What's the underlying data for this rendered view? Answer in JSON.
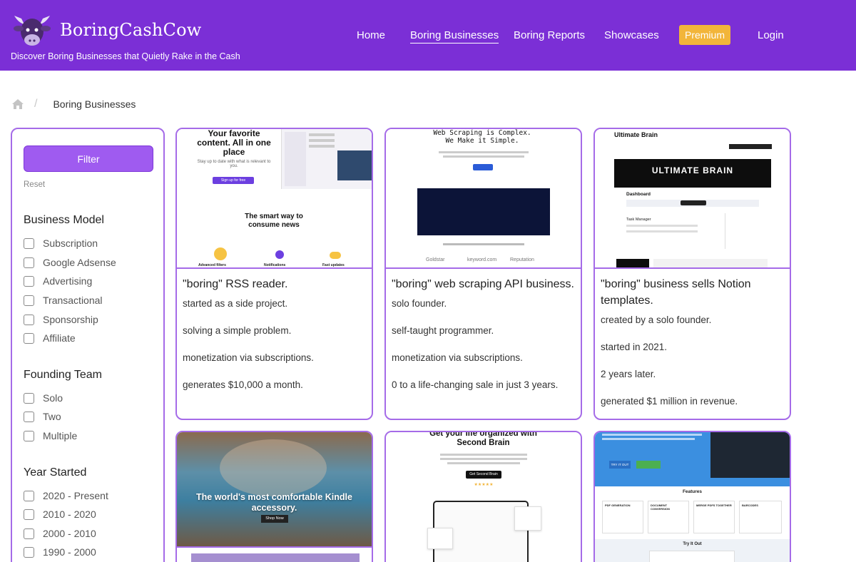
{
  "header": {
    "brand": "BoringCashCow",
    "tagline": "Discover Boring Businesses that Quietly Rake in the Cash",
    "nav": [
      {
        "label": "Home"
      },
      {
        "label": "Boring Businesses"
      },
      {
        "label": "Boring Reports"
      },
      {
        "label": "Showcases"
      },
      {
        "label": "Premium"
      },
      {
        "label": "Login"
      }
    ],
    "active_nav": "Boring Businesses"
  },
  "breadcrumb": {
    "separator": "/",
    "current": "Boring Businesses"
  },
  "sidebar": {
    "filter_label": "Filter",
    "reset_label": "Reset",
    "groups": [
      {
        "title": "Business Model",
        "options": [
          "Subscription",
          "Google Adsense",
          "Advertising",
          "Transactional",
          "Sponsorship",
          "Affiliate"
        ]
      },
      {
        "title": "Founding Team",
        "options": [
          "Solo",
          "Two",
          "Multiple"
        ]
      },
      {
        "title": "Year Started",
        "options": [
          "2020 - Present",
          "2010 - 2020",
          "2000 - 2010",
          "1990 - 2000"
        ]
      }
    ]
  },
  "cards": [
    {
      "title": "\"boring\" RSS reader.",
      "lines": [
        "started as a side project.",
        "solving a simple problem.",
        "monetization via subscriptions.",
        "generates $10,000 a month."
      ],
      "thumb": {
        "headline": "Your favorite content. All in one place",
        "sub": "Stay up to date with what is relevant to you.",
        "cta": "Sign up for free",
        "section": "The smart way to consume news",
        "features": [
          "Advanced filters",
          "Notifications",
          "Fast updates"
        ]
      }
    },
    {
      "title": "\"boring\" web scraping API business.",
      "lines": [
        "solo founder.",
        "self-taught programmer.",
        "monetization via subscriptions.",
        "0 to a life-changing sale in just 3 years."
      ],
      "thumb": {
        "headline": "Web Scraping is Complex. We Make it Simple.",
        "logos": [
          "Goldstar",
          "keyword.com",
          "Reputation"
        ]
      }
    },
    {
      "title": "\"boring\" business sells Notion templates.",
      "lines": [
        "created by a solo founder.",
        "started in 2021.",
        "2 years later.",
        "generated $1 million in revenue."
      ],
      "thumb": {
        "headline": "Ultimate Brain",
        "banner": "ULTIMATE BRAIN",
        "section": "Dashboard",
        "sub": "Task Manager"
      }
    },
    {
      "title": "",
      "lines": [],
      "thumb": {
        "headline": "The world's most comfortable Kindle accessory.",
        "cta": "Shop Now"
      }
    },
    {
      "title": "",
      "lines": [],
      "thumb": {
        "headline": "Get your life organized with Second Brain",
        "cta": "Get Second Brain",
        "rating": "★★★★★"
      }
    },
    {
      "title": "",
      "lines": [],
      "thumb": {
        "section": "Features",
        "features": [
          "PDF GENERATION",
          "DOCUMENT CONVERSION",
          "MERGE PDFS TOGETHER",
          "BARCODES"
        ],
        "cta": "TRY IT OUT",
        "sub": "Try It Out"
      }
    }
  ],
  "colors": {
    "brand_purple": "#7b2fd6",
    "card_border": "#a56be8",
    "premium": "#f2b53a"
  }
}
